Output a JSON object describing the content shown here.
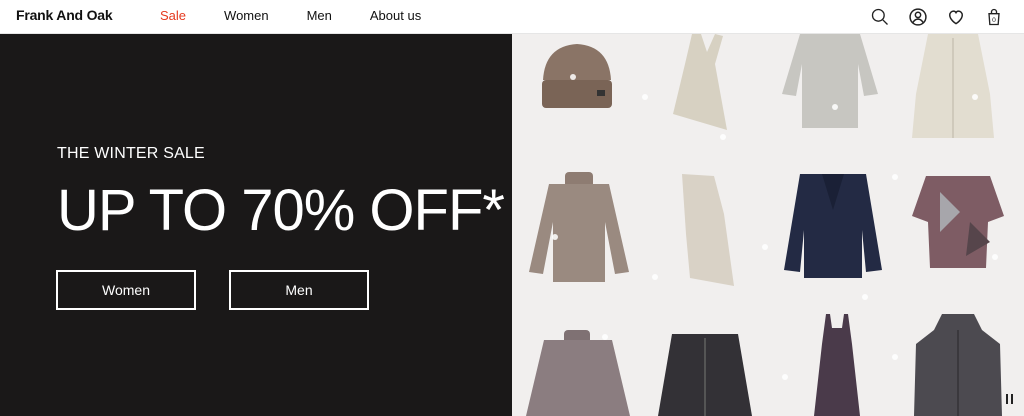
{
  "brand": {
    "name": "Frank And Oak"
  },
  "nav": {
    "items": [
      {
        "label": "Sale",
        "highlight": true,
        "color": "#e5391f"
      },
      {
        "label": "Women"
      },
      {
        "label": "Men"
      },
      {
        "label": "About us"
      }
    ],
    "icons": [
      "search-icon",
      "account-icon",
      "heart-icon",
      "cart-icon"
    ],
    "cart_count": "0"
  },
  "hero": {
    "eyebrow": "THE WINTER SALE",
    "headline": "UP TO 70% OFF*",
    "buttons": [
      {
        "label": "Women"
      },
      {
        "label": "Men"
      }
    ],
    "background_color": "#1a1818"
  },
  "product_grid": {
    "items": [
      "beanie",
      "halter-top",
      "knit-sweater",
      "puffer-coat",
      "turtleneck",
      "satin-skirt",
      "blazer",
      "printed-shirt",
      "mock-neck-sweater",
      "cardigan",
      "slip-dress",
      "hooded-puffer"
    ]
  }
}
